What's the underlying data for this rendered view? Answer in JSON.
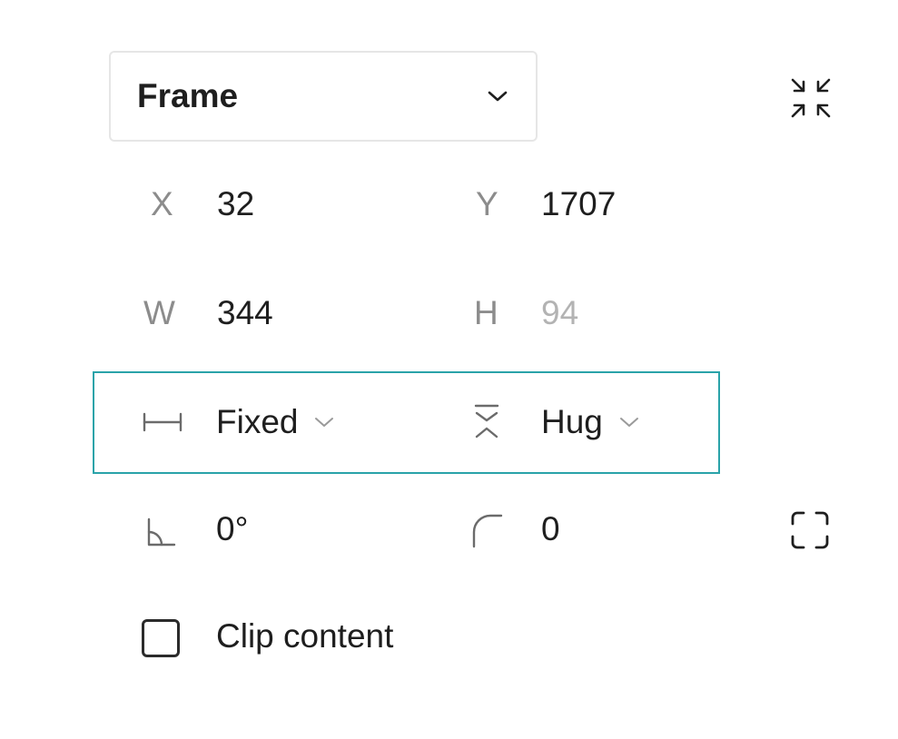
{
  "frame_select": {
    "value": "Frame"
  },
  "position": {
    "x_label": "X",
    "x_value": "32",
    "y_label": "Y",
    "y_value": "1707"
  },
  "size": {
    "w_label": "W",
    "w_value": "344",
    "h_label": "H",
    "h_value": "94"
  },
  "sizing": {
    "horizontal_mode": "Fixed",
    "vertical_mode": "Hug"
  },
  "transform": {
    "rotation_value": "0°",
    "corner_radius_value": "0"
  },
  "clip_content": {
    "label": "Clip content",
    "checked": false
  },
  "icons": {
    "collapse": "collapse-arrows-icon",
    "chevron": "chevron-down-icon",
    "horizontal_resizing": "horizontal-resizing-icon",
    "vertical_resizing": "vertical-resizing-icon",
    "rotation": "rotation-angle-icon",
    "corner_radius": "corner-radius-icon",
    "independent_corners": "independent-corners-icon"
  },
  "colors": {
    "selection_outline": "#2aa3a9",
    "text_primary": "#1e1e1e",
    "text_secondary": "#8c8c8c",
    "text_disabled": "#b3b3b3"
  }
}
